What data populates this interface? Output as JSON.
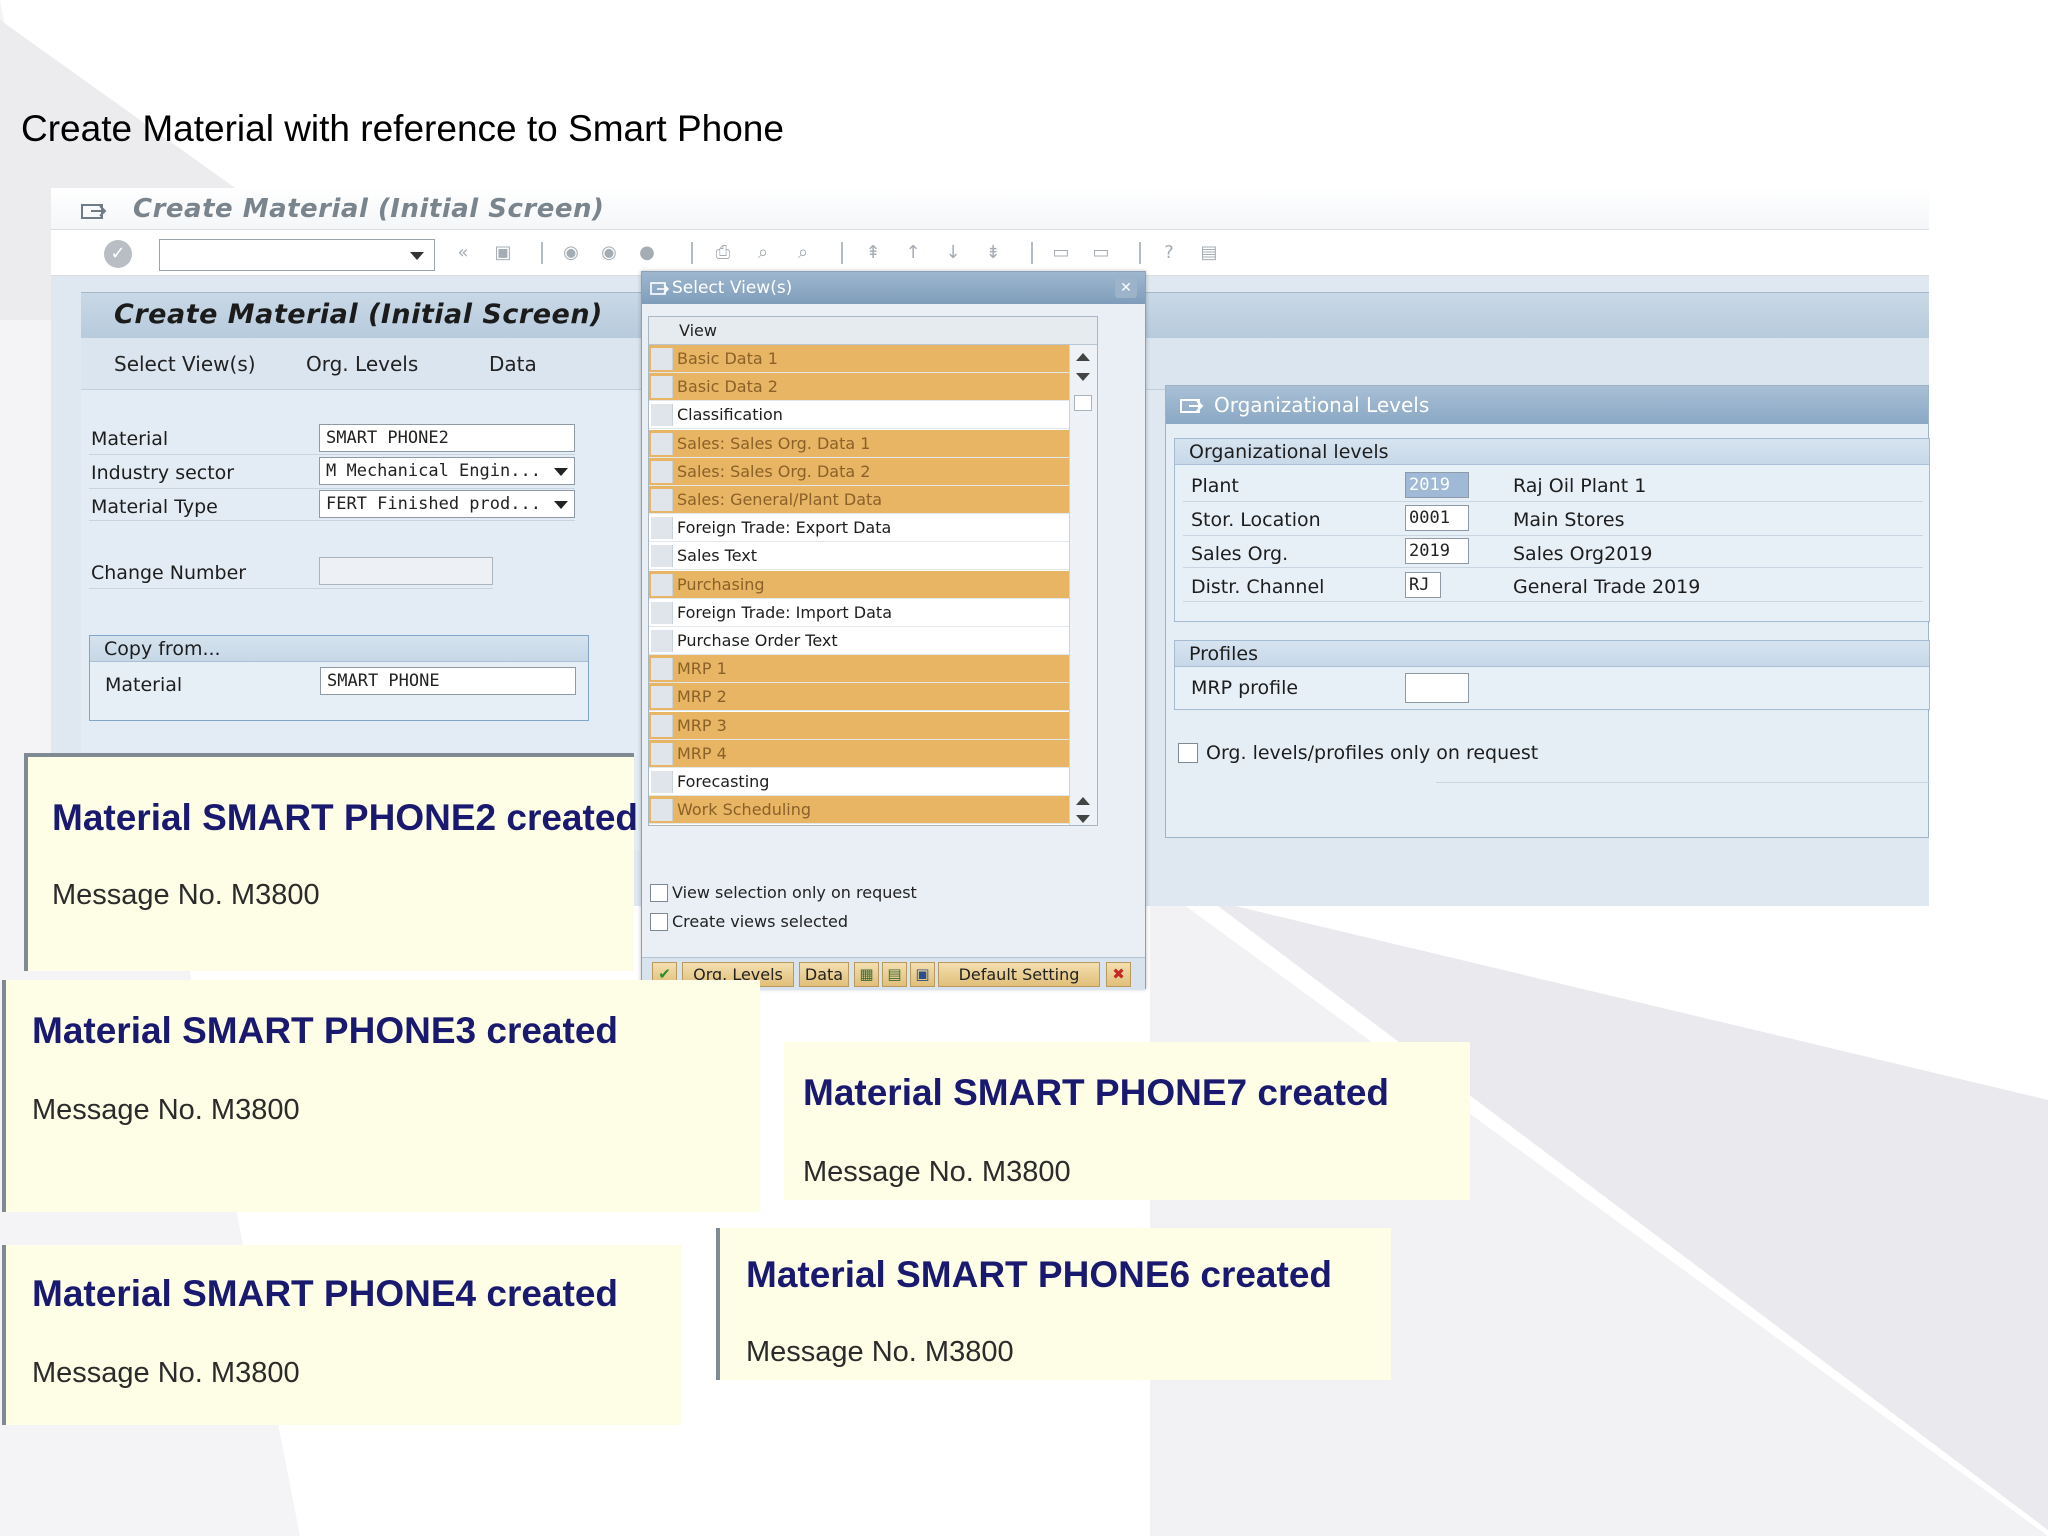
{
  "slide_title": "Create Material with reference to Smart Phone",
  "window": {
    "title": "Create Material (Initial Screen)",
    "page_title": "Create Material (Initial Screen)",
    "app_toolbar": [
      "Select View(s)",
      "Org. Levels",
      "Data"
    ]
  },
  "form": {
    "material_label": "Material",
    "material_value": "SMART PHONE2",
    "industry_label": "Industry sector",
    "industry_value": "M Mechanical Engin...",
    "type_label": "Material Type",
    "type_value": "FERT Finished prod...",
    "change_label": "Change Number",
    "change_value": "",
    "copy_group_title": "Copy from...",
    "copy_material_label": "Material",
    "copy_material_value": "SMART PHONE"
  },
  "select_views": {
    "title": "Select View(s)",
    "column_header": "View",
    "rows": [
      {
        "label": "Basic Data 1",
        "selected": true
      },
      {
        "label": "Basic Data 2",
        "selected": true
      },
      {
        "label": "Classification",
        "selected": false
      },
      {
        "label": "Sales: Sales Org. Data 1",
        "selected": true
      },
      {
        "label": "Sales: Sales Org. Data 2",
        "selected": true
      },
      {
        "label": "Sales: General/Plant Data",
        "selected": true
      },
      {
        "label": "Foreign Trade: Export Data",
        "selected": false
      },
      {
        "label": "Sales Text",
        "selected": false
      },
      {
        "label": "Purchasing",
        "selected": true
      },
      {
        "label": "Foreign Trade: Import Data",
        "selected": false
      },
      {
        "label": "Purchase Order Text",
        "selected": false
      },
      {
        "label": "MRP 1",
        "selected": true
      },
      {
        "label": "MRP 2",
        "selected": true
      },
      {
        "label": "MRP 3",
        "selected": true
      },
      {
        "label": "MRP 4",
        "selected": true
      },
      {
        "label": "Forecasting",
        "selected": false
      },
      {
        "label": "Work Scheduling",
        "selected": true
      }
    ],
    "option_view_selection": "View selection only on request",
    "option_create_views": "Create views selected",
    "btn_org_levels": "Org. Levels",
    "btn_data": "Data",
    "btn_default_setting": "Default Setting"
  },
  "org_levels": {
    "title": "Organizational Levels",
    "group_title": "Organizational levels",
    "rows": [
      {
        "label": "Plant",
        "value": "2019",
        "desc": "Raj Oil Plant 1"
      },
      {
        "label": "Stor. Location",
        "value": "0001",
        "desc": "Main Stores"
      },
      {
        "label": "Sales Org.",
        "value": "2019",
        "desc": "Sales Org2019"
      },
      {
        "label": "Distr. Channel",
        "value": "RJ",
        "desc": "General Trade 2019"
      }
    ],
    "profiles_title": "Profiles",
    "mrp_profile_label": "MRP profile",
    "mrp_profile_value": "",
    "only_on_request": "Org. levels/profiles only on request"
  },
  "messages": [
    {
      "title": "Material SMART PHONE2 created",
      "number": "Message No. M3800"
    },
    {
      "title": "Material SMART PHONE3 created",
      "number": "Message No. M3800"
    },
    {
      "title": "Material SMART PHONE7 created",
      "number": "Message No. M3800"
    },
    {
      "title": "Material SMART PHONE4 created",
      "number": "Message No. M3800"
    },
    {
      "title": "Material SMART PHONE6 created",
      "number": "Message No. M3800"
    }
  ],
  "colors": {
    "selected_row": "#e8b564",
    "message_title": "#191970",
    "message_bg": "#fefee6"
  }
}
